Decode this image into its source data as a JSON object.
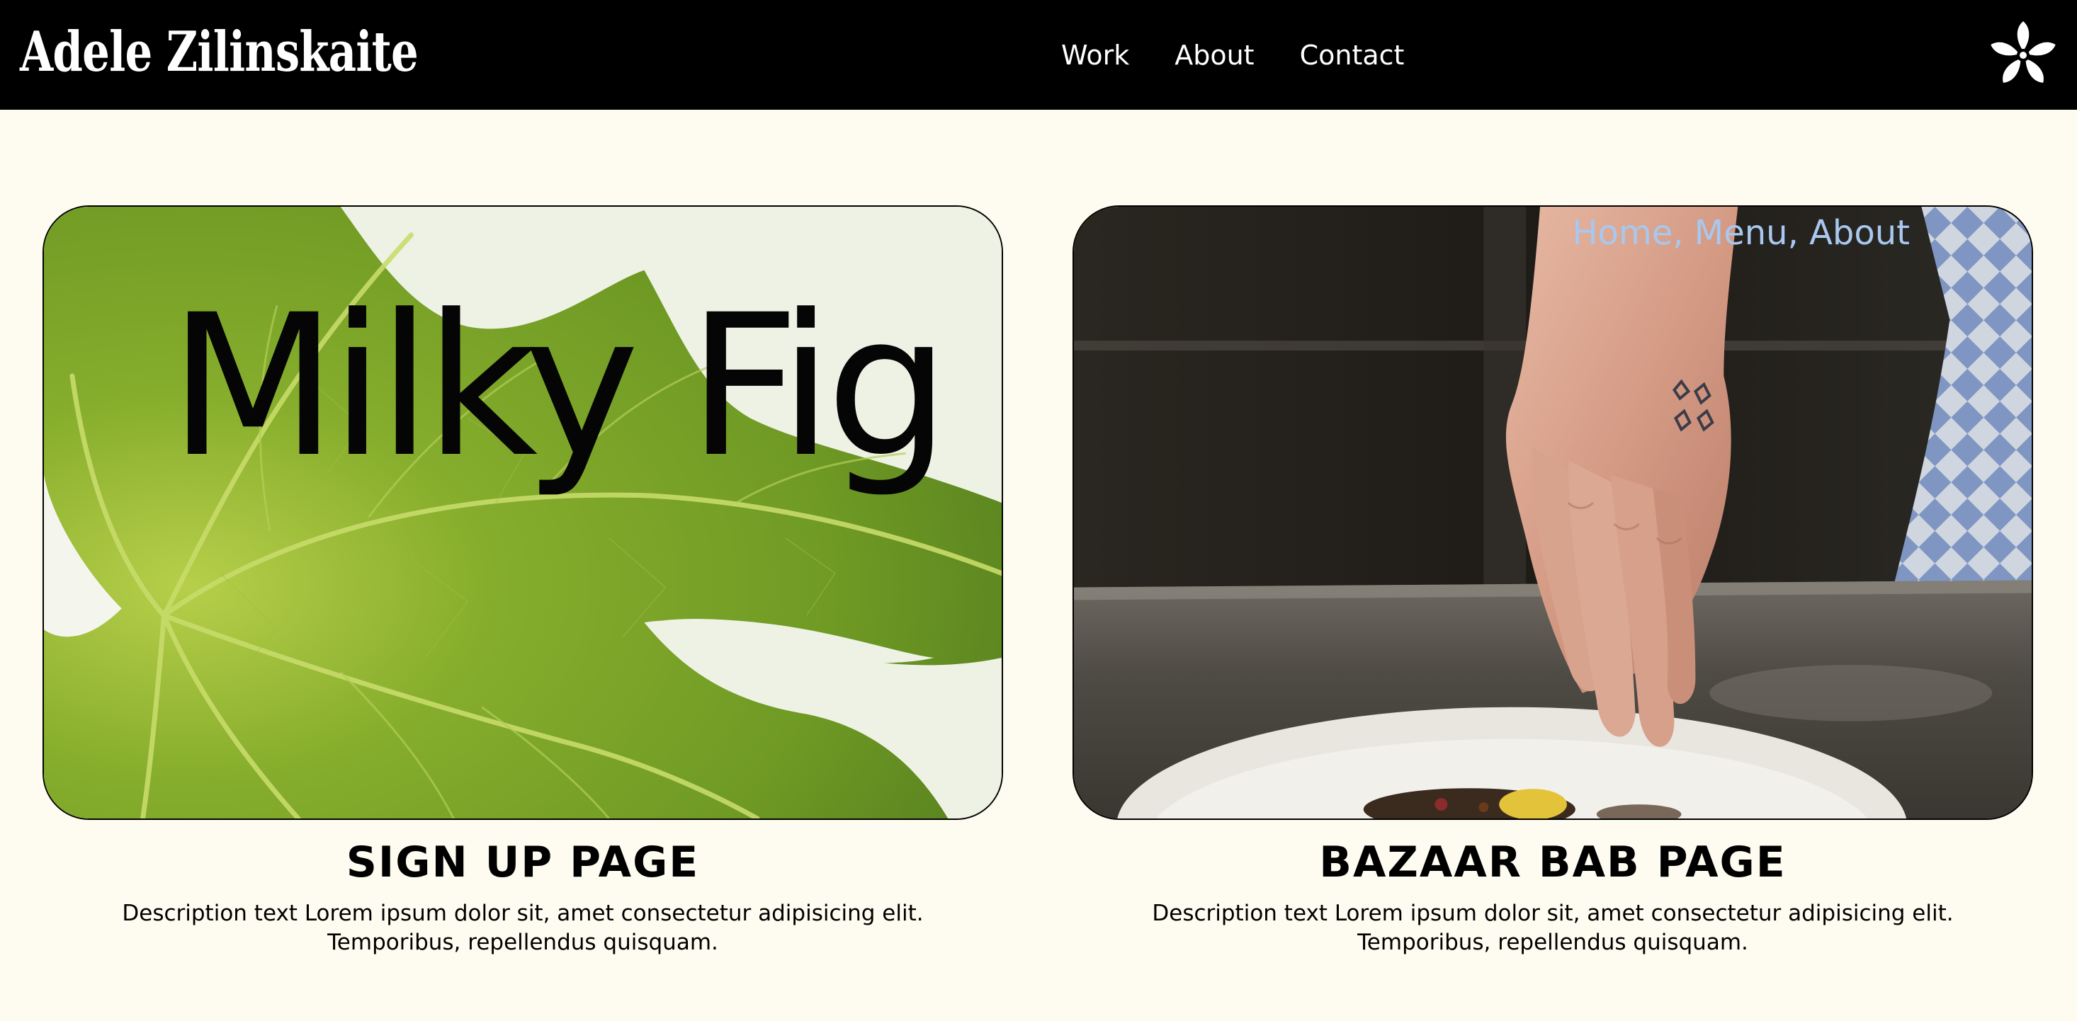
{
  "header": {
    "logo_text": "Adele Zilinskaite",
    "nav": [
      "Work",
      "About",
      "Contact"
    ],
    "emblem_icon": "flower-icon"
  },
  "cards": [
    {
      "overlay_title": "Milky Fig",
      "image": "fig-leaf-photo",
      "title": "SIGN UP PAGE",
      "description_line1": "Description text Lorem ipsum dolor sit, amet consectetur adipisicing elit.",
      "description_line2": "Temporibus, repellendus quisquam."
    },
    {
      "overlay_links": "Home, Menu, About",
      "image": "chef-hand-plating-photo",
      "title": "BAZAAR BAB PAGE",
      "description_line1": "Description text Lorem ipsum dolor sit, amet consectetur adipisicing elit.",
      "description_line2": "Temporibus, repellendus quisquam."
    }
  ],
  "colors": {
    "background": "#fefcf0",
    "header": "#000000",
    "leaf_green": "#7aa52a",
    "overlay_link": "#a8c8ef"
  }
}
